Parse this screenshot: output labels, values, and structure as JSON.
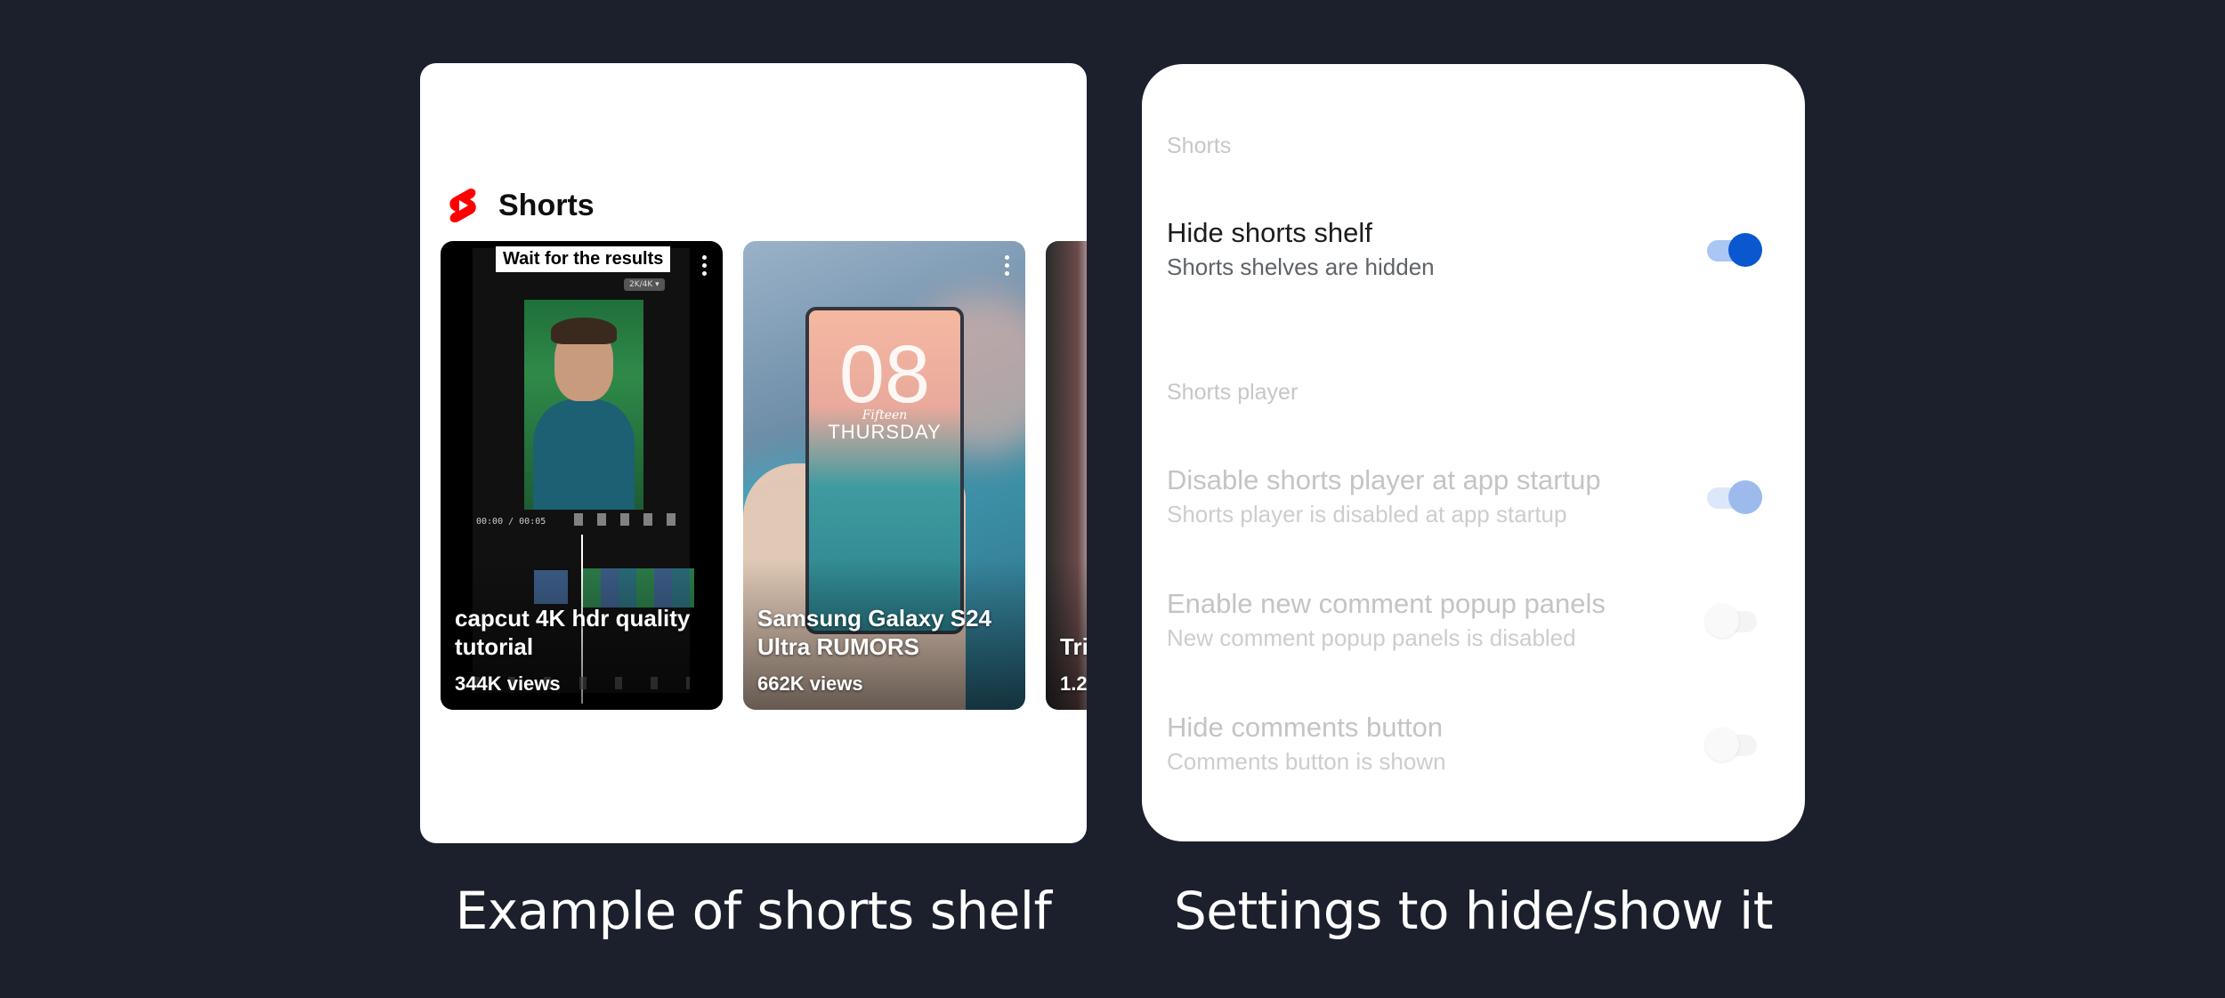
{
  "captions": {
    "left": "Example of shorts shelf",
    "right": "Settings to hide/show it"
  },
  "shelf": {
    "title": "Shorts",
    "logo_icon": "youtube-shorts-logo",
    "brand_color": "#ff0000",
    "cards": [
      {
        "title": "capcut 4K hdr quality tutorial",
        "views": "344K views",
        "overlay_text": "Wait for the results",
        "editor_time": "00:00 / 00:05",
        "resolution_chip": "2K/4K ▾"
      },
      {
        "title": "Samsung Galaxy S24 Ultra RUMORS",
        "views": "662K views",
        "phone_clock": "08",
        "phone_day": "THURSDAY",
        "phone_signature": "Fifteen"
      },
      {
        "title": "Tri",
        "views": "1.2"
      }
    ]
  },
  "settings": {
    "accent_color": "#0b57d0",
    "sections": [
      {
        "header": "Shorts",
        "items": [
          {
            "title": "Hide shorts shelf",
            "subtitle": "Shorts shelves are hidden",
            "enabled": true,
            "checked": true
          }
        ]
      },
      {
        "header": "Shorts player",
        "items": [
          {
            "title": "Disable shorts player at app startup",
            "subtitle": "Shorts player is disabled at app startup",
            "enabled": false,
            "checked": true
          },
          {
            "title": "Enable new comment popup panels",
            "subtitle": "New comment popup panels is disabled",
            "enabled": false,
            "checked": false
          },
          {
            "title": "Hide comments button",
            "subtitle": "Comments button is shown",
            "enabled": false,
            "checked": false
          }
        ]
      }
    ]
  }
}
